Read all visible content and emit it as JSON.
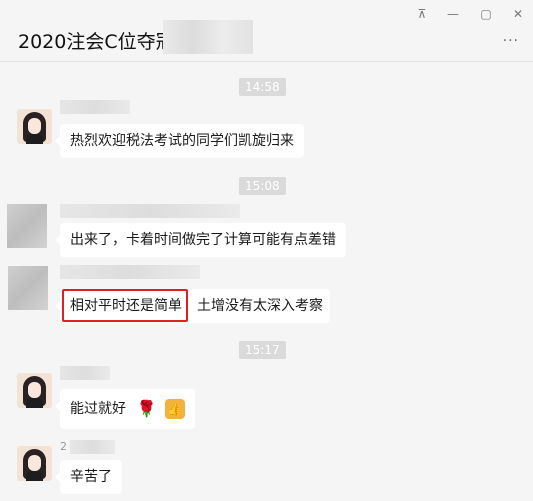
{
  "window": {
    "title": "2020注会C位夺冠",
    "controls": [
      "pin-icon",
      "minimize-icon",
      "maximize-icon",
      "close-icon"
    ],
    "more_icon": "more-icon"
  },
  "messages": [
    {
      "type": "time",
      "text": "14:58"
    },
    {
      "type": "msg",
      "sender": "teacher",
      "text": "热烈欢迎税法考试的同学们凯旋归来"
    },
    {
      "type": "time",
      "text": "15:08"
    },
    {
      "type": "msg",
      "sender": "blurred-1",
      "text": "出来了，卡着时间做完了计算可能有点差错"
    },
    {
      "type": "msg",
      "sender": "blurred-2",
      "text_part1": "相对平时还是简单",
      "text_part2": "土增没有太深入考察"
    },
    {
      "type": "time",
      "text": "15:17"
    },
    {
      "type": "msg",
      "sender": "teacher",
      "text": "能过就好"
    },
    {
      "type": "msg",
      "sender": "teacher",
      "sender_label": "2",
      "text": "辛苦了"
    }
  ],
  "colors": {
    "highlight": "#e02020",
    "bubble": "#ffffff",
    "background": "#f5f5f5"
  }
}
